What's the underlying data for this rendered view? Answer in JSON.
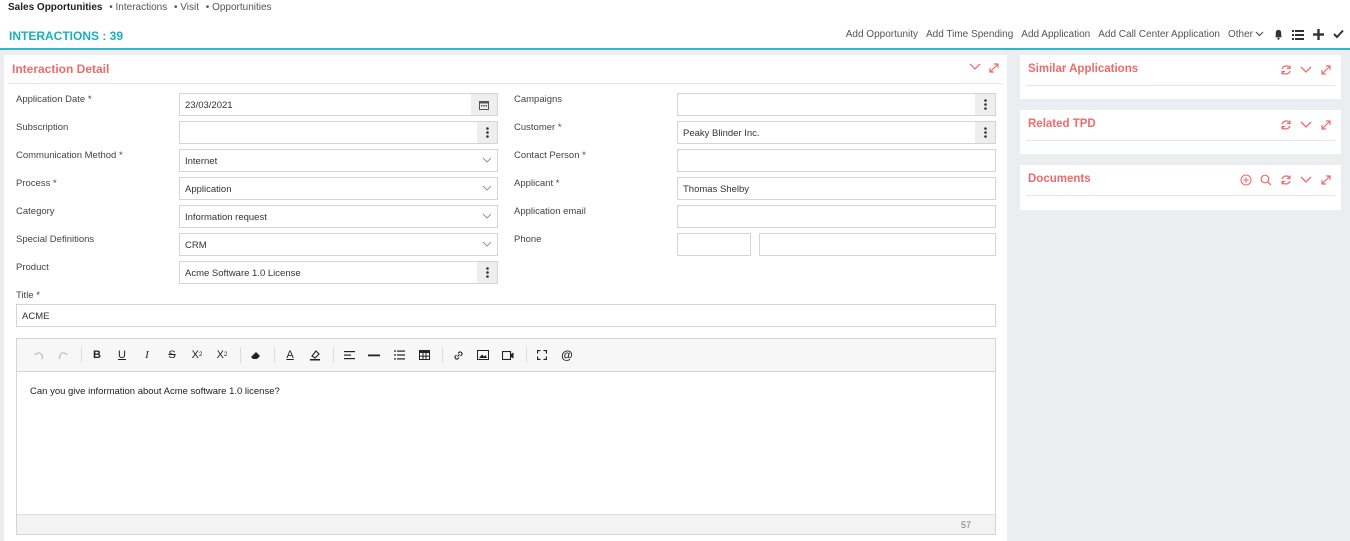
{
  "breadcrumb": {
    "root": "Sales Opportunities",
    "items": [
      "• Interactions",
      "• Visit",
      "• Opportunities"
    ]
  },
  "header": {
    "title": "INTERACTIONS : 39",
    "actions": [
      "Add Opportunity",
      "Add Time Spending",
      "Add Application",
      "Add Call Center Application",
      "Other"
    ]
  },
  "panel": {
    "title": "Interaction Detail"
  },
  "form": {
    "application_date": {
      "label": "Application Date *",
      "value": "23/03/2021"
    },
    "subscription": {
      "label": "Subscription",
      "value": ""
    },
    "communication_method": {
      "label": "Communication Method *",
      "value": "Internet"
    },
    "process": {
      "label": "Process *",
      "value": "Application"
    },
    "category": {
      "label": "Category",
      "value": "Information request"
    },
    "special_definitions": {
      "label": "Special Definitions",
      "value": "CRM"
    },
    "product": {
      "label": "Product",
      "value": "Acme Software 1.0 License"
    },
    "campaigns": {
      "label": "Campaigns",
      "value": ""
    },
    "customer": {
      "label": "Customer *",
      "value": "Peaky Blinder Inc."
    },
    "contact_person": {
      "label": "Contact Person *",
      "value": ""
    },
    "applicant": {
      "label": "Applicant *",
      "value": "Thomas Shelby"
    },
    "application_email": {
      "label": "Application email",
      "value": ""
    },
    "phone": {
      "label": "Phone",
      "code": "",
      "number": ""
    },
    "title": {
      "label": "Title *",
      "value": "ACME"
    }
  },
  "editor": {
    "content": "Can you give information about Acme software 1.0 license?",
    "char_count": "57"
  },
  "side_panels": [
    {
      "title": "Similar Applications"
    },
    {
      "title": "Related TPD"
    },
    {
      "title": "Documents"
    }
  ],
  "colors": {
    "accent": "#18b0bd",
    "panel_title": "#ee6b6b"
  }
}
